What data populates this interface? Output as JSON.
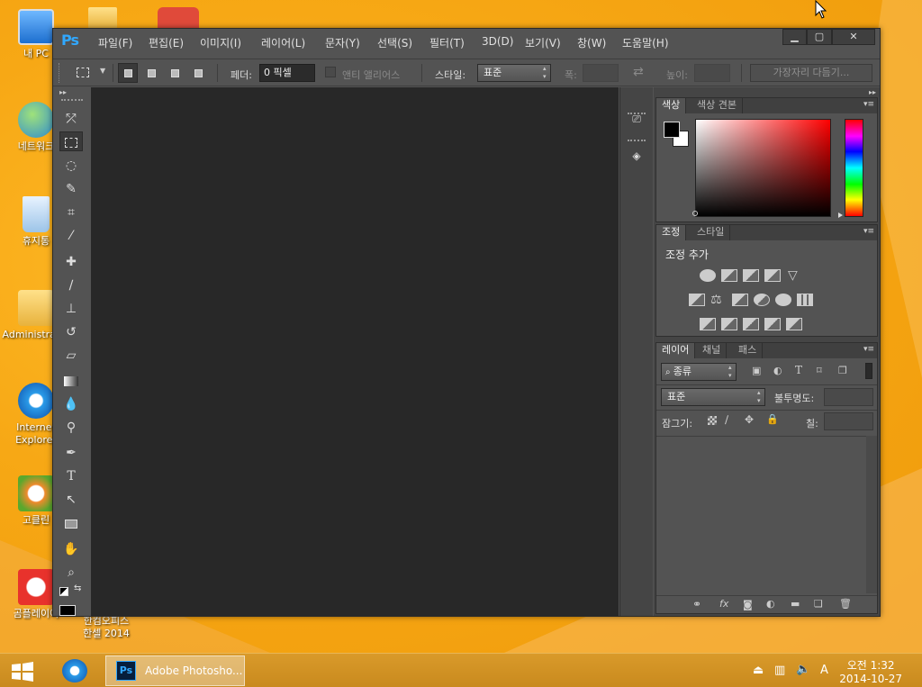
{
  "desktop": {
    "icons": [
      {
        "label": "내 PC",
        "icon": "computer-icon"
      },
      {
        "label": "네트워크",
        "icon": "network-icon"
      },
      {
        "label": "휴지통",
        "icon": "recycle-bin-icon"
      },
      {
        "label": "Administrator",
        "icon": "user-folder-icon"
      },
      {
        "label": "Internet Explorer",
        "icon": "ie-icon"
      },
      {
        "label": "고클린",
        "icon": "goclean-icon"
      },
      {
        "label": "곰플레이어",
        "icon": "gomplayer-icon"
      },
      {
        "label": "한컴오피스 한셀 2014",
        "icon": "hancell-icon"
      }
    ]
  },
  "window": {
    "logo": "Ps",
    "menu": [
      "파일(F)",
      "편집(E)",
      "이미지(I)",
      "레이어(L)",
      "문자(Y)",
      "선택(S)",
      "필터(T)",
      "3D(D)",
      "보기(V)",
      "창(W)",
      "도움말(H)"
    ],
    "controls": {
      "minimize": "▁",
      "maximize": "▢",
      "close": "✕"
    }
  },
  "options": {
    "feather_label": "페더:",
    "feather_value": "0 픽셀",
    "antialias_label": "앤티 앨리어스",
    "style_label": "스타일:",
    "style_value": "표준",
    "width_label": "폭:",
    "height_label": "높이:",
    "refine_label": "가장자리 다듬기..."
  },
  "panels": {
    "color": {
      "tabs": [
        "색상",
        "색상 견본"
      ],
      "foreground": "#000000",
      "background": "#ffffff"
    },
    "adjustments": {
      "tabs": [
        "조정",
        "스타일"
      ],
      "heading": "조정 추가"
    },
    "layers": {
      "tabs": [
        "레이어",
        "채널",
        "패스"
      ],
      "filter_kind": "종류",
      "blend_mode": "표준",
      "opacity_label": "불투명도:",
      "lock_label": "잠그기:",
      "fill_label": "칠:"
    }
  },
  "taskbar": {
    "task_label": "Adobe Photosho...",
    "time": "오전 1:32",
    "date": "2014-10-27",
    "ime": "A"
  },
  "colors": {
    "accent": "#31a8ff",
    "canvas": "#282828",
    "panel": "#535353"
  }
}
